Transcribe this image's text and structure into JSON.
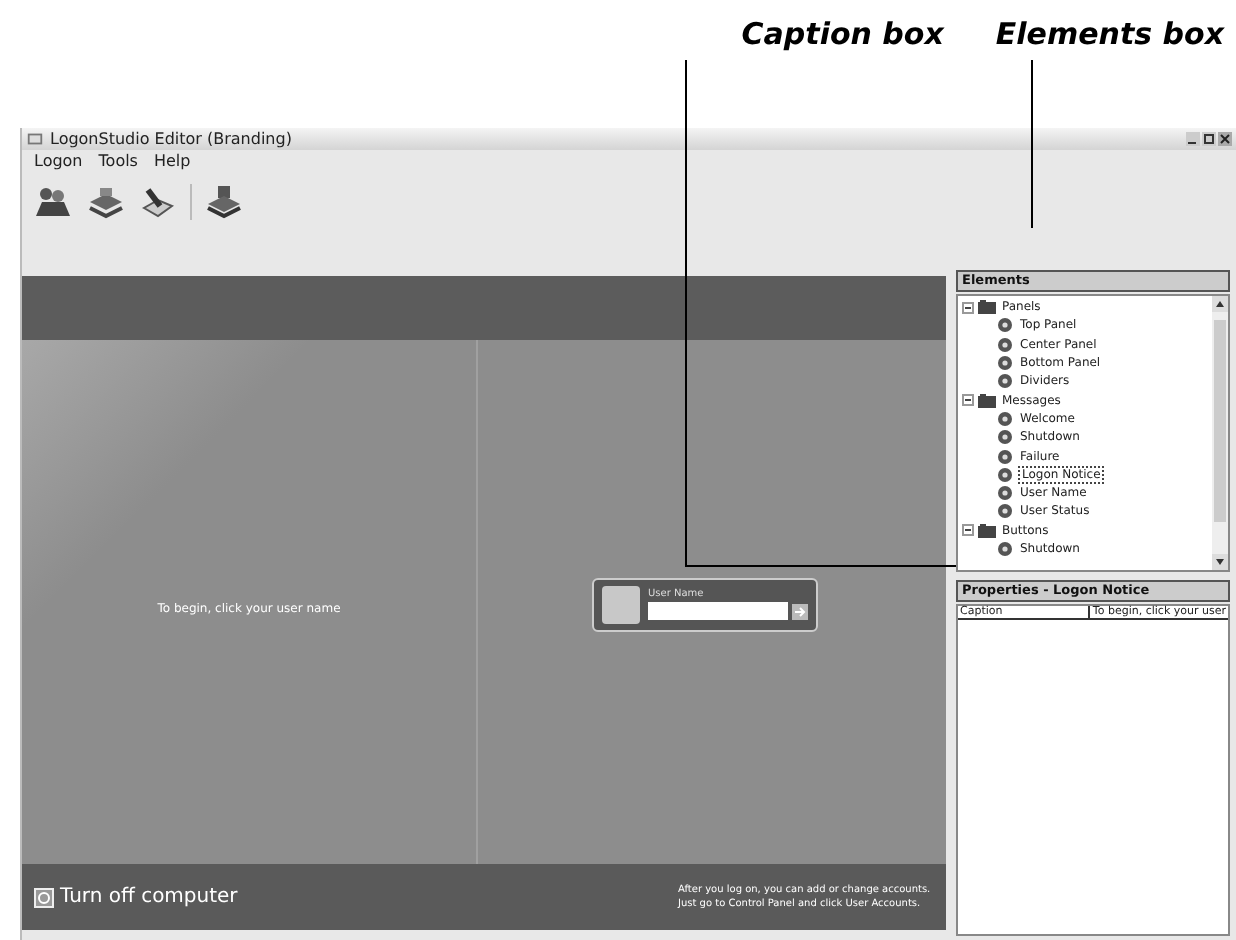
{
  "callouts": [
    {
      "label": "Caption box"
    },
    {
      "label": "Elements box"
    }
  ],
  "window": {
    "title": "LogonStudio Editor (Branding)",
    "menu": [
      "Logon",
      "Tools",
      "Help"
    ]
  },
  "preview": {
    "instruction": "To begin, click your user name",
    "user_label": "User Name",
    "shutdown": "Turn off computer",
    "hint": "After you log on, you can add or change accounts. Just go to Control Panel and click User Accounts."
  },
  "elements": {
    "title": "Elements",
    "tree": [
      {
        "label": "Panels",
        "expanded": true,
        "selected": false,
        "children": [
          {
            "label": "Top Panel",
            "selected": false
          },
          {
            "label": "Center Panel",
            "selected": false
          },
          {
            "label": "Bottom Panel",
            "selected": false
          },
          {
            "label": "Dividers",
            "selected": false
          }
        ]
      },
      {
        "label": "Messages",
        "expanded": true,
        "selected": false,
        "children": [
          {
            "label": "Welcome",
            "selected": false
          },
          {
            "label": "Shutdown",
            "selected": false
          },
          {
            "label": "Failure",
            "selected": false
          },
          {
            "label": "Logon Notice",
            "selected": true
          },
          {
            "label": "User Name",
            "selected": false
          },
          {
            "label": "User Status",
            "selected": false
          }
        ]
      },
      {
        "label": "Buttons",
        "expanded": true,
        "selected": false,
        "children": [
          {
            "label": "Shutdown",
            "selected": false
          }
        ]
      }
    ]
  },
  "properties": {
    "title": "Properties - Logon Notice",
    "rows": [
      {
        "name": "Caption",
        "value": "To begin, click your user"
      }
    ]
  }
}
